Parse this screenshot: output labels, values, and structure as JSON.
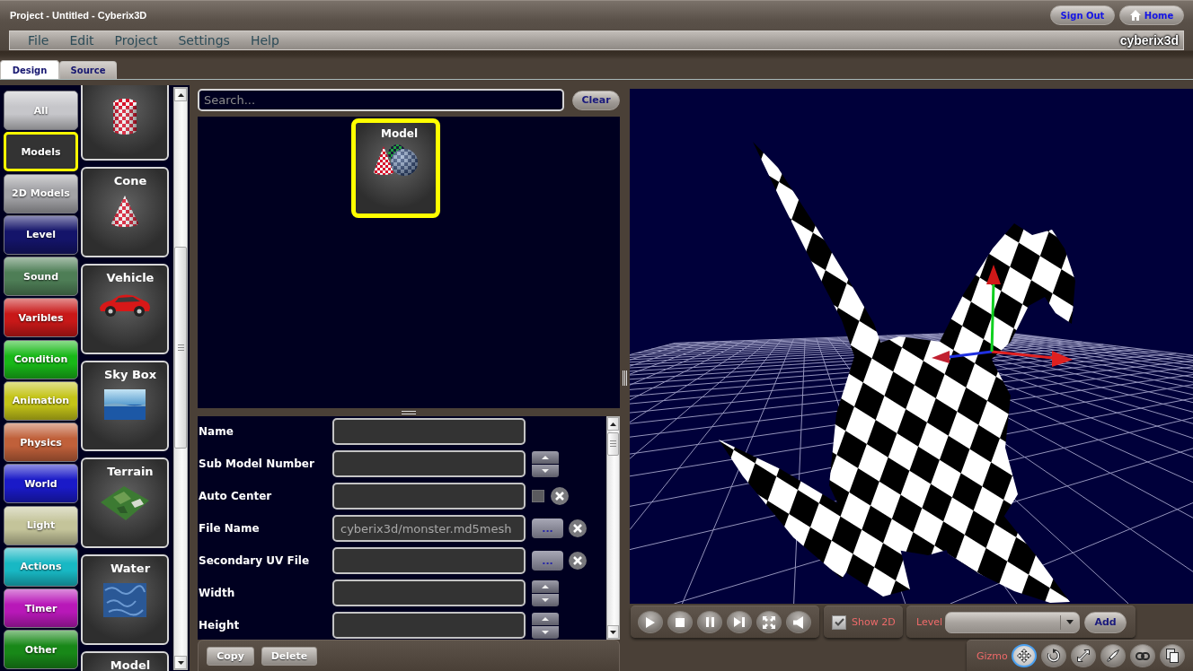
{
  "window": {
    "title": "Project - Untitled - Cyberix3D"
  },
  "header_buttons": [
    {
      "label": "Sign Out",
      "kind": "signout"
    },
    {
      "label": "Home",
      "kind": "home"
    }
  ],
  "menu": [
    "File",
    "Edit",
    "Project",
    "Settings",
    "Help"
  ],
  "brand": "cyberix3d",
  "tabs": [
    {
      "label": "Design",
      "selected": true
    },
    {
      "label": "Source",
      "selected": false
    }
  ],
  "categories": [
    {
      "label": "All",
      "color": "#c6c6ca",
      "selected": false
    },
    {
      "label": "Models",
      "color": "#333333",
      "selected": true
    },
    {
      "label": "2D Models",
      "color": "#a2a2a6",
      "selected": false
    },
    {
      "label": "Level",
      "color": "#14146a",
      "selected": false
    },
    {
      "label": "Sound",
      "color": "#4e7e56",
      "selected": false
    },
    {
      "label": "Varibles",
      "color": "#c81818",
      "selected": false
    },
    {
      "label": "Condition",
      "color": "#18b818",
      "selected": false
    },
    {
      "label": "Animation",
      "color": "#c4c418",
      "selected": false
    },
    {
      "label": "Physics",
      "color": "#c0603a",
      "selected": false
    },
    {
      "label": "World",
      "color": "#1a1ac8",
      "selected": false
    },
    {
      "label": "Light",
      "color": "#c4c49a",
      "selected": false
    },
    {
      "label": "Actions",
      "color": "#18b8c4",
      "selected": false
    },
    {
      "label": "Timer",
      "color": "#b818b8",
      "selected": false
    },
    {
      "label": "Other",
      "color": "#188818",
      "selected": false
    }
  ],
  "palette": [
    {
      "kind": "cylinder"
    },
    {
      "label": "Cone",
      "kind": "cone"
    },
    {
      "label": "Vehicle",
      "kind": "vehicle"
    },
    {
      "label": "Sky Box",
      "kind": "skybox"
    },
    {
      "label": "Terrain",
      "kind": "terrain"
    },
    {
      "label": "Water",
      "kind": "water"
    },
    {
      "label": "Model"
    }
  ],
  "search": {
    "placeholder": "Search..."
  },
  "clear_button": "Clear",
  "library": [
    {
      "label": "Model",
      "kind": "shapes",
      "selected": true
    }
  ],
  "properties": [
    {
      "label": "Name",
      "kind": "text"
    },
    {
      "label": "Sub Model Number",
      "kind": "spinner"
    },
    {
      "label": "Auto Center",
      "kind": "checkbox",
      "checked": false
    },
    {
      "label": "File Name",
      "kind": "file",
      "value": "cyberix3d/monster.md5mesh",
      "browse": "..."
    },
    {
      "label": "Secondary UV File",
      "kind": "file",
      "browse": "..."
    },
    {
      "label": "Width",
      "kind": "spinner"
    },
    {
      "label": "Height",
      "kind": "spinner"
    }
  ],
  "property_buttons": [
    "Copy",
    "Delete"
  ],
  "show_2d": {
    "label": "Show 2D",
    "checked": true
  },
  "level_picker": {
    "label": "Level",
    "add_button": "Add"
  },
  "gizmo": {
    "label": "Gizmo",
    "tools": [
      {
        "kind": "move",
        "selected": true
      },
      {
        "kind": "rotate",
        "selected": false
      },
      {
        "kind": "scale",
        "selected": false
      },
      {
        "kind": "pen",
        "selected": false
      },
      {
        "kind": "link",
        "selected": false
      },
      {
        "kind": "copy",
        "selected": false
      }
    ]
  }
}
